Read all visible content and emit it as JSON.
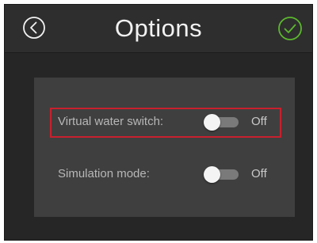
{
  "header": {
    "title": "Options",
    "back_icon": "back-arrow-circle-icon",
    "confirm_icon": "check-circle-icon",
    "confirm_color": "#5cb82e"
  },
  "settings": [
    {
      "label": "Virtual water switch:",
      "state": "Off",
      "highlighted": true
    },
    {
      "label": "Simulation mode:",
      "state": "Off",
      "highlighted": false
    }
  ],
  "colors": {
    "highlight": "#c8202e",
    "background": "#262626",
    "panel": "#3f3f3f"
  }
}
